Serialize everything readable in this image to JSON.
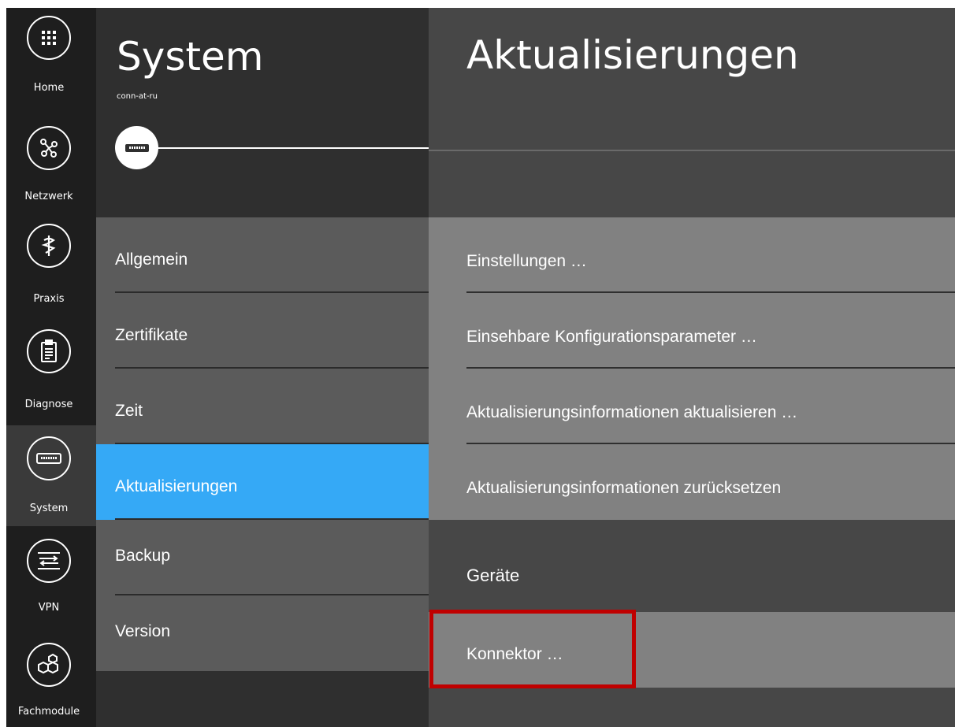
{
  "rail": {
    "items": [
      {
        "label": "Home",
        "icon": "grid-icon",
        "active": false
      },
      {
        "label": "Netzwerk",
        "icon": "network-icon",
        "active": false
      },
      {
        "label": "Praxis",
        "icon": "medical-icon",
        "active": false
      },
      {
        "label": "Diagnose",
        "icon": "clipboard-icon",
        "active": false
      },
      {
        "label": "System",
        "icon": "device-icon",
        "active": true
      },
      {
        "label": "VPN",
        "icon": "vpn-icon",
        "active": false
      },
      {
        "label": "Fachmodule",
        "icon": "modules-icon",
        "active": false
      }
    ]
  },
  "middle": {
    "title": "System",
    "subtitle": "conn-at-ru",
    "menu": [
      {
        "label": "Allgemein",
        "active": false
      },
      {
        "label": "Zertifikate",
        "active": false
      },
      {
        "label": "Zeit",
        "active": false
      },
      {
        "label": "Aktualisierungen",
        "active": true
      },
      {
        "label": "Backup",
        "active": false
      },
      {
        "label": "Version",
        "active": false
      }
    ]
  },
  "right": {
    "title": "Aktualisierungen",
    "actions": [
      {
        "label": "Einstellungen …"
      },
      {
        "label": "Einsehbare Konfigurationsparameter …"
      },
      {
        "label": "Aktualisierungsinformationen aktualisieren …"
      },
      {
        "label": "Aktualisierungsinformationen zurücksetzen"
      }
    ],
    "section_header": "Geräte",
    "devices": [
      {
        "label": "Konnektor …"
      }
    ]
  },
  "colors": {
    "accent": "#35a9f6",
    "highlight": "#c00000"
  }
}
